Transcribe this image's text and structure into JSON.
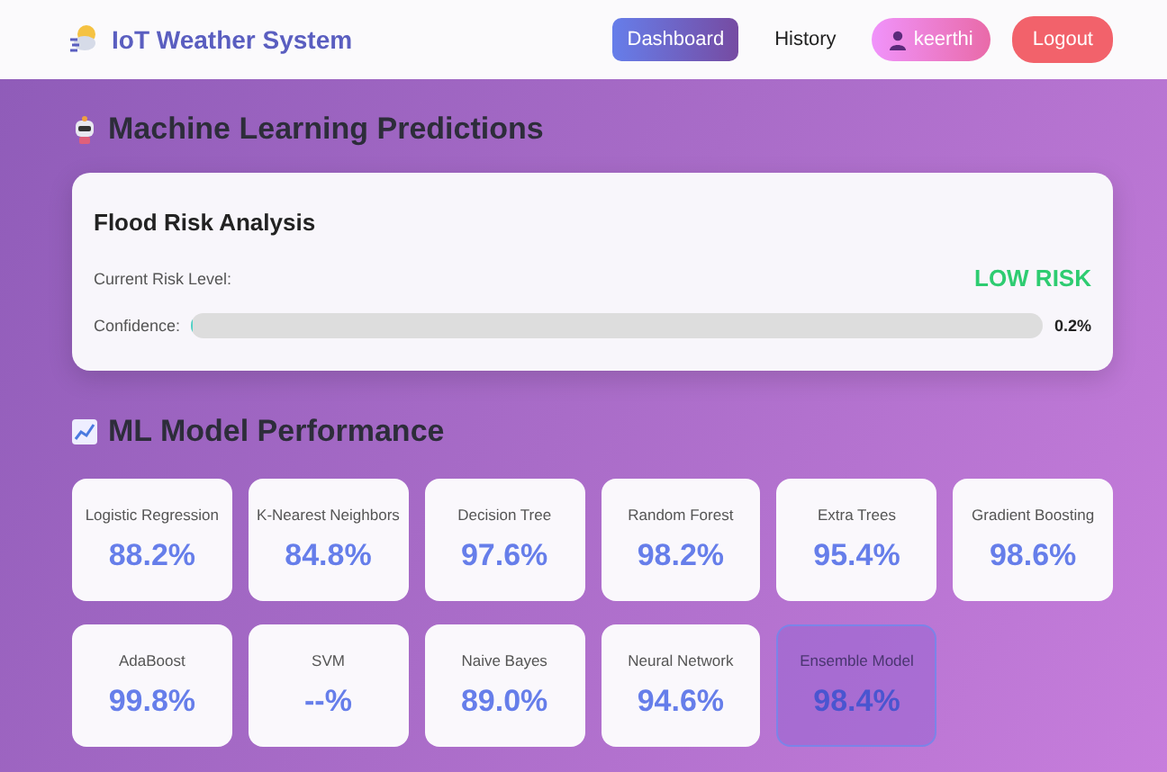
{
  "navbar": {
    "brand": "IoT Weather System",
    "links": [
      {
        "label": "Dashboard",
        "selected": true
      },
      {
        "label": "History",
        "selected": false
      }
    ],
    "user": "keerthi",
    "logout": "Logout"
  },
  "predictions": {
    "title": "Machine Learning Predictions",
    "card": {
      "title": "Flood Risk Analysis",
      "risk_label": "Current Risk Level:",
      "risk_value": "LOW RISK",
      "confidence_label": "Confidence:",
      "confidence": {
        "level": 0.002,
        "reading": "0.2%"
      }
    }
  },
  "performance": {
    "title": "ML Model Performance",
    "models": [
      {
        "name": "Logistic Regression",
        "accuracy": "88.2%",
        "kind": "model"
      },
      {
        "name": "K-Nearest Neighbors",
        "accuracy": "84.8%",
        "kind": "model"
      },
      {
        "name": "Decision Tree",
        "accuracy": "97.6%",
        "kind": "model"
      },
      {
        "name": "Random Forest",
        "accuracy": "98.2%",
        "kind": "model"
      },
      {
        "name": "Extra Trees",
        "accuracy": "95.4%",
        "kind": "model"
      },
      {
        "name": "Gradient Boosting",
        "accuracy": "98.6%",
        "kind": "model"
      },
      {
        "name": "AdaBoost",
        "accuracy": "99.8%",
        "kind": "model"
      },
      {
        "name": "SVM",
        "accuracy": "--%",
        "kind": "model"
      },
      {
        "name": "Naive Bayes",
        "accuracy": "89.0%",
        "kind": "model"
      },
      {
        "name": "Neural Network",
        "accuracy": "94.6%",
        "kind": "model"
      },
      {
        "name": "Ensemble Model",
        "accuracy": "98.4%",
        "kind": "ensemble"
      }
    ]
  }
}
